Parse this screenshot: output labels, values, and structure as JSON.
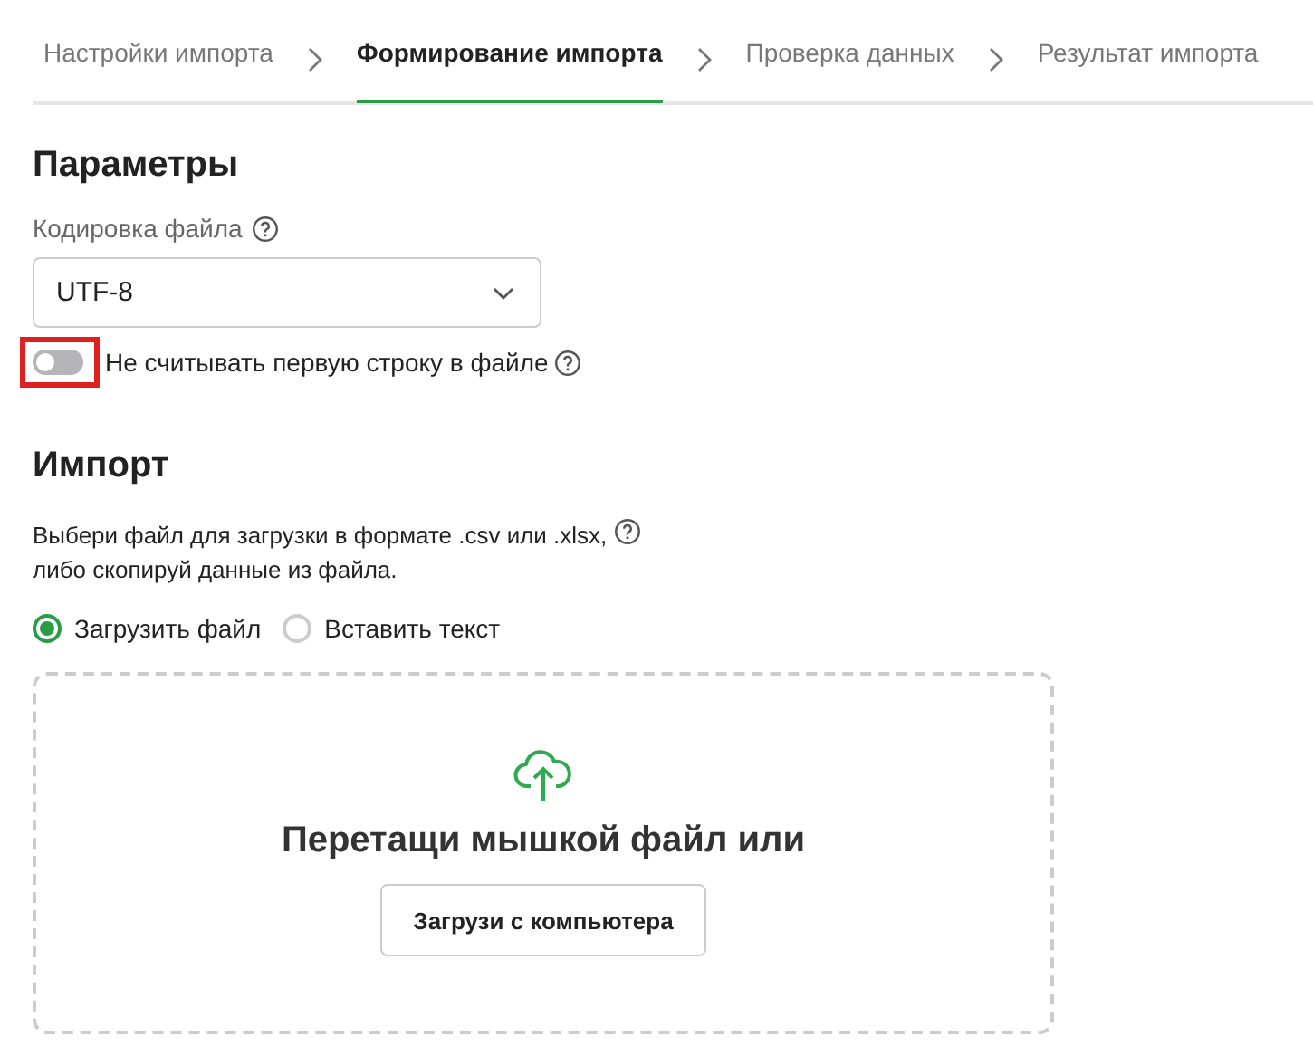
{
  "steps": [
    {
      "label": "Настройки импорта",
      "selected": false
    },
    {
      "label": "Формирование импорта",
      "selected": true
    },
    {
      "label": "Проверка данных",
      "selected": false
    },
    {
      "label": "Результат импорта",
      "selected": false
    }
  ],
  "parameters": {
    "heading": "Параметры",
    "encoding_label": "Кодировка файла",
    "encoding_value": "UTF-8",
    "skip_first_row": {
      "label": "Не считывать первую строку в файле",
      "on": false,
      "highlighted": true
    }
  },
  "import": {
    "heading": "Импорт",
    "description": "Выбери файл для загрузки в формате .csv или .xlsx,\nлибо скопируй данные из файла.",
    "modes": [
      {
        "label": "Загрузить файл",
        "selected": true
      },
      {
        "label": "Вставить текст",
        "selected": false
      }
    ],
    "dropzone": {
      "title": "Перетащи мышкой файл или",
      "button": "Загрузи с компьютера"
    }
  }
}
